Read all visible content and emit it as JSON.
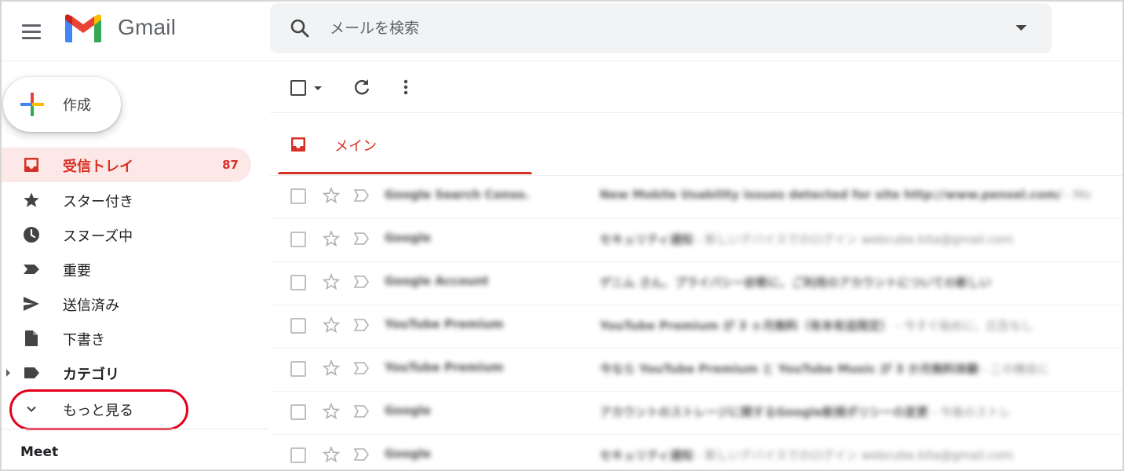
{
  "app": {
    "name": "Gmail",
    "icons": {
      "menu": "hamburger-menu-icon",
      "logo": "gmail-logo"
    }
  },
  "search": {
    "placeholder": "メールを検索",
    "value": "",
    "icon": "search-icon",
    "options_icon": "dropdown-caret-icon"
  },
  "compose": {
    "label": "作成",
    "icon": "compose-plus-icon"
  },
  "sidebar": {
    "items": [
      {
        "label": "受信トレイ",
        "count": "87",
        "icon": "inbox-icon",
        "active": true
      },
      {
        "label": "スター付き",
        "icon": "star-icon"
      },
      {
        "label": "スヌーズ中",
        "icon": "clock-icon"
      },
      {
        "label": "重要",
        "icon": "important-icon"
      },
      {
        "label": "送信済み",
        "icon": "send-icon"
      },
      {
        "label": "下書き",
        "icon": "draft-icon"
      },
      {
        "label": "カテゴリ",
        "icon": "label-icon",
        "expandable": true
      },
      {
        "label": "もっと見る",
        "icon": "chevron-down-icon",
        "highlighted": true
      }
    ],
    "meet_label": "Meet"
  },
  "toolbar": {
    "select_icon": "checkbox-icon",
    "refresh_icon": "refresh-icon",
    "more_icon": "more-vert-icon"
  },
  "tabs": [
    {
      "label": "メイン",
      "icon": "inbox-icon",
      "active": true
    }
  ],
  "emails": [
    {
      "sender": "Google Search Conso.",
      "subject": "New Mobile Usability issues detected for site http://www.pensel.com/",
      "snippet": " - Mo"
    },
    {
      "sender": "Google",
      "subject": "セキュリティ通知",
      "snippet": " - 新しいデバイスでのログイン webcube.kita@gmail.com"
    },
    {
      "sender": "Google Account",
      "subject": "ゲニム さん、プライバシー診断に、ご利用のアカウントについての新しい",
      "snippet": ""
    },
    {
      "sender": "YouTube Premium",
      "subject": "YouTube Premium が 3 ヶ月無料（有本有追限定）",
      "snippet": " - 今すぐ始めに、広告なし"
    },
    {
      "sender": "YouTube Premium",
      "subject": "今なら YouTube Premium と YouTube Music が 3 か月無料体験",
      "snippet": " - この機会に"
    },
    {
      "sender": "Google",
      "subject": "アカウントのストレージに関するGoogle新規ポリシーの変更",
      "snippet": " - 今後のストレ"
    },
    {
      "sender": "Google",
      "subject": "セキュリティ通知",
      "snippet": " - 新しいデバイスでのログイン webcube.kita@gmail.com"
    }
  ],
  "colors": {
    "accent_red": "#d93025",
    "active_bg": "#fce8e6",
    "search_bg": "#f1f3f4",
    "highlight_ring": "#e4001b",
    "icon_gray": "#5f6368"
  }
}
